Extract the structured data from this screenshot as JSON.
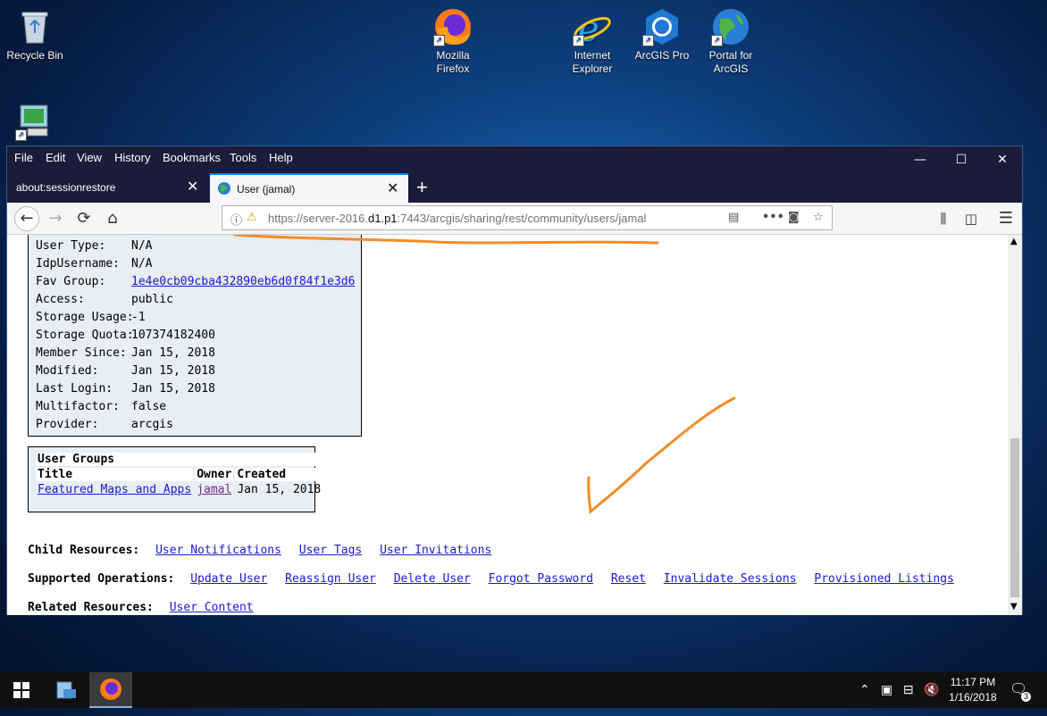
{
  "desktop": {
    "icons": [
      {
        "label": "Recycle Bin"
      },
      {
        "label": "Mozilla Firefox"
      },
      {
        "label": "Internet Explorer"
      },
      {
        "label": "ArcGIS Pro"
      },
      {
        "label": "Portal for ArcGIS"
      }
    ]
  },
  "menubar": {
    "file": "File",
    "edit": "Edit",
    "view": "View",
    "history": "History",
    "bookmarks": "Bookmarks",
    "tools": "Tools",
    "help": "Help"
  },
  "tabs": [
    {
      "label": "about:sessionrestore"
    },
    {
      "label": "User (jamal)"
    }
  ],
  "address": {
    "prefix": "https://server-2016.",
    "host": "d1.p1",
    "suffix": ":7443/arcgis/sharing/rest/community/users/jamal"
  },
  "user": {
    "rows": [
      {
        "key": "User Type:",
        "value": "N/A"
      },
      {
        "key": "IdpUsername:",
        "value": "N/A"
      },
      {
        "key": "Fav Group:",
        "value": "1e4e0cb09cba432890eb6d0f84f1e3d6"
      },
      {
        "key": "Access:",
        "value": "public"
      },
      {
        "key": "Storage Usage:",
        "value": "-1"
      },
      {
        "key": "Storage Quota:",
        "value": "107374182400"
      },
      {
        "key": "Member Since:",
        "value": "Jan 15, 2018"
      },
      {
        "key": "Modified:",
        "value": "Jan 15, 2018"
      },
      {
        "key": "Last Login:",
        "value": "Jan 15, 2018"
      },
      {
        "key": "Multifactor:",
        "value": "false"
      },
      {
        "key": "Provider:",
        "value": "arcgis"
      }
    ]
  },
  "groups": {
    "title": "User Groups",
    "headers": [
      "Title",
      "Owner",
      "Created"
    ],
    "row": {
      "title": "Featured Maps and Apps",
      "owner": "jamal",
      "created": "Jan 15, 2018"
    }
  },
  "child_resources": {
    "label": "Child Resources:",
    "links": [
      "User Notifications",
      "User Tags",
      "User Invitations"
    ]
  },
  "supported_operations": {
    "label": "Supported Operations:",
    "links": [
      "Update User",
      "Reassign User",
      "Delete User",
      "Forgot Password",
      "Reset",
      "Invalidate Sessions",
      "Provisioned Listings"
    ]
  },
  "related_resources": {
    "label": "Related Resources:",
    "links": [
      "User Content"
    ]
  },
  "taskbar": {
    "time": "11:17 PM",
    "date": "1/16/2018",
    "notifications": "3"
  },
  "colors": {
    "annotation": "#f28c28",
    "link": "#1a1ad2",
    "panel_bg": "#e7eef5"
  }
}
